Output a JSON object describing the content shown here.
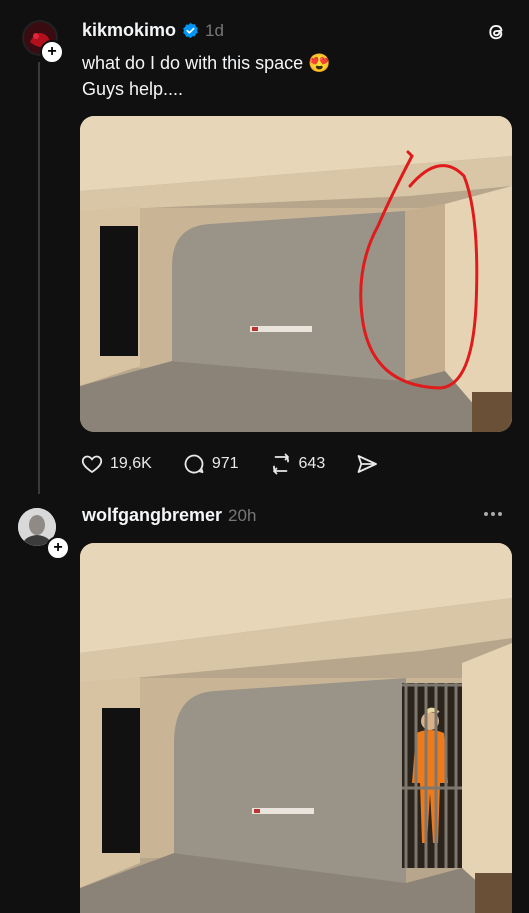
{
  "posts": [
    {
      "username": "kikmokimo",
      "verified": true,
      "time": "1d",
      "text_line1": "what do I do with this space",
      "emoji": "😍",
      "text_line2": "Guys help....",
      "image_desc": "room-with-wall-circled",
      "actions": {
        "likes": "19,6K",
        "replies": "971",
        "reposts": "643"
      }
    },
    {
      "username": "wolfgangbremer",
      "time": "20h",
      "image_desc": "room-with-prisoner-in-cell"
    }
  ],
  "icons": {
    "threads_logo": "threads-logo-icon",
    "more": "more-icon"
  },
  "colors": {
    "background": "#101010",
    "text": "#f3f5f7",
    "muted": "#777777",
    "verified": "#0095f6"
  }
}
